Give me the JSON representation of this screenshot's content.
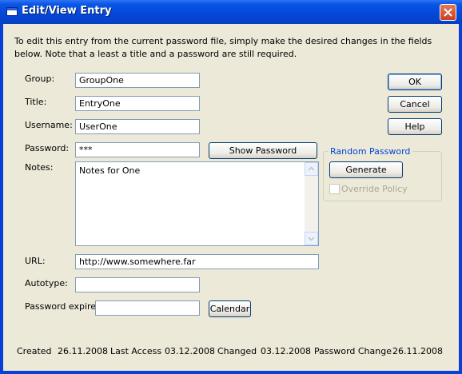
{
  "window": {
    "title": "Edit/View Entry"
  },
  "intro_text": "To edit this entry from the current password file, simply make the desired changes in the fields below. Note that a least a title and a password are still required.",
  "fields": {
    "group": {
      "label": "Group:",
      "value": "GroupOne"
    },
    "title": {
      "label": "Title:",
      "value": "EntryOne"
    },
    "username": {
      "label": "Username:",
      "value": "UserOne"
    },
    "password": {
      "label": "Password:",
      "value": "***"
    },
    "notes": {
      "label": "Notes:",
      "value": "Notes for One"
    },
    "url": {
      "label": "URL:",
      "value": "http://www.somewhere.far"
    },
    "autotype": {
      "label": "Autotype:",
      "value": ""
    },
    "password_expires": {
      "label": "Password expires:",
      "value": ""
    }
  },
  "buttons": {
    "ok": "OK",
    "cancel": "Cancel",
    "help": "Help",
    "show_password": "Show Password",
    "generate": "Generate",
    "calendar": "Calendar"
  },
  "random_password": {
    "group_title": "Random Password",
    "override_policy": "Override Policy",
    "override_checked": false
  },
  "footer": {
    "created_label": "Created",
    "created_value": "26.11.2008",
    "last_access_label": "Last Access",
    "last_access_value": "03.12.2008",
    "changed_label": "Changed",
    "changed_value": "03.12.2008",
    "password_change_label": "Password Change",
    "password_change_value": "26.11.2008"
  }
}
